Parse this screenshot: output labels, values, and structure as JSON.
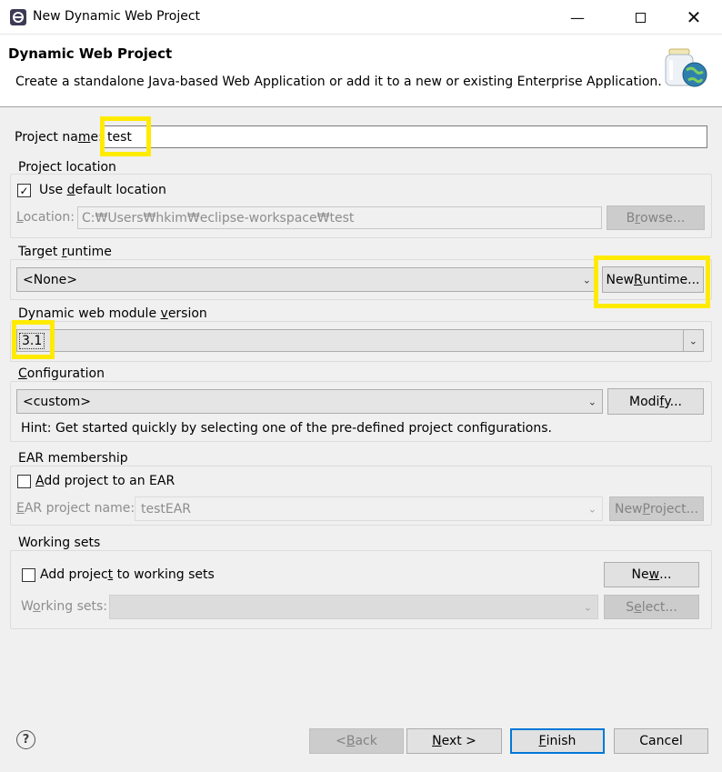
{
  "window": {
    "title": "New Dynamic Web Project",
    "minimize_icon": "minimize-icon",
    "maximize_icon": "maximize-icon",
    "close_icon": "close-icon"
  },
  "banner": {
    "title": "Dynamic Web Project",
    "description": "Create a standalone Java-based Web Application or add it to a new or existing Enterprise Application."
  },
  "project_name": {
    "label_pre": "Project na",
    "label_u": "m",
    "label_post": "e:",
    "value": "test"
  },
  "project_location": {
    "group_label": "Project location",
    "use_default": {
      "pre": "Use ",
      "u": "d",
      "post": "efault location",
      "checked": true
    },
    "location_label": {
      "u": "L",
      "post": "ocation:"
    },
    "location_value": "C:₩Users₩hkim₩eclipse-workspace₩test",
    "browse": {
      "pre": "B",
      "u": "r",
      "post": "owse..."
    }
  },
  "target_runtime": {
    "group_label": {
      "pre": "Target ",
      "u": "r",
      "post": "untime"
    },
    "selected": "<None>",
    "new_runtime": {
      "pre": "New ",
      "u": "R",
      "post": "untime..."
    }
  },
  "module_version": {
    "group_label": {
      "pre": "Dynamic web module ",
      "u": "v",
      "post": "ersion"
    },
    "selected": "3.1"
  },
  "configuration": {
    "group_label": {
      "u": "C",
      "post": "onfiguration"
    },
    "selected": "<custom>",
    "modify": {
      "pre": "Modi",
      "u": "f",
      "post": "y..."
    },
    "hint": "Hint: Get started quickly by selecting one of the pre-defined project configurations."
  },
  "ear": {
    "group_label": "EAR membership",
    "add_to_ear": {
      "u": "A",
      "post": "dd project to an EAR",
      "checked": false
    },
    "ear_name_label": {
      "u": "E",
      "post": "AR project name:"
    },
    "ear_name_value": "testEAR",
    "new_project": {
      "pre": "New ",
      "u": "P",
      "post": "roject..."
    }
  },
  "working_sets": {
    "group_label": "Working sets",
    "add_to_ws": {
      "pre": "Add projec",
      "u": "t",
      "post": " to working sets",
      "checked": false
    },
    "new": {
      "pre": "Ne",
      "u": "w",
      "post": "..."
    },
    "ws_label": {
      "pre": "W",
      "u": "o",
      "post": "rking sets:"
    },
    "select": {
      "pre": "S",
      "u": "e",
      "post": "lect..."
    }
  },
  "footer": {
    "help_icon": "help-icon",
    "back": {
      "pre": "< ",
      "u": "B",
      "post": "ack"
    },
    "next": {
      "u": "N",
      "post": "ext >"
    },
    "finish": {
      "u": "F",
      "post": "inish"
    },
    "cancel": "Cancel"
  },
  "colors": {
    "highlight": "#ffeb00",
    "accent": "#0078d7"
  }
}
